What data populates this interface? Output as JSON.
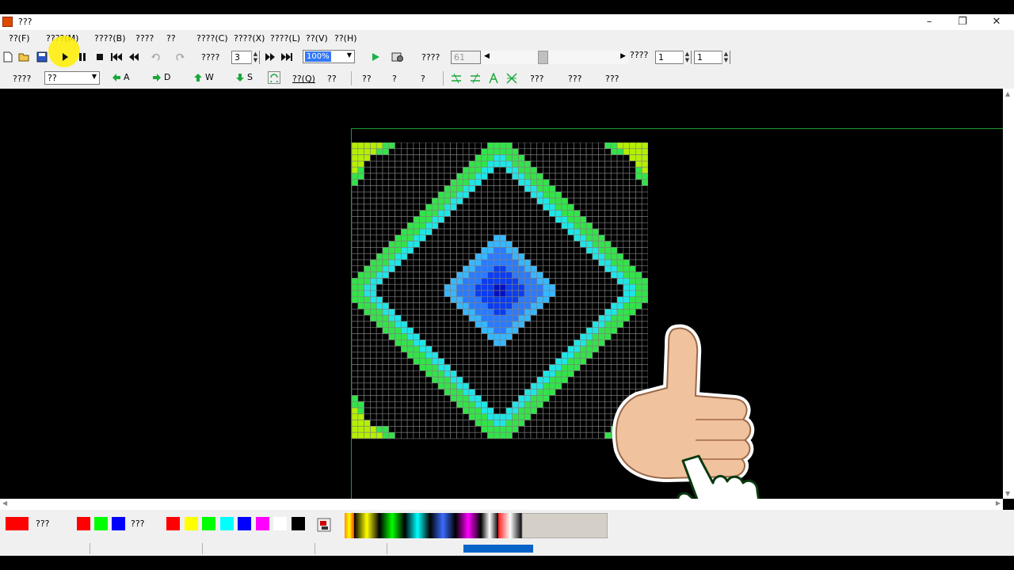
{
  "window": {
    "title": "???"
  },
  "menu": [
    "??(F)",
    "????(M)",
    "????(B)",
    "????",
    "??",
    "????(C)",
    "????(X)",
    "????(L)",
    "??(V)",
    "??(H)"
  ],
  "toolbar1": {
    "speed_label": "????",
    "speed_value": "3",
    "zoom_value": "100%",
    "frame_label": "????",
    "frame_value": "61",
    "page_label": "????",
    "page_value": "1",
    "page_total": "1"
  },
  "toolbar2": {
    "label_a": "????",
    "select_value": "??",
    "dir_left": "A",
    "dir_right": "D",
    "dir_up": "W",
    "dir_down": "S",
    "btn_q": "??(Q)",
    "btn_1": "??",
    "btn_2": "??",
    "btn_3": "?",
    "btn_4": "?",
    "btn_5": "???",
    "btn_6": "???",
    "btn_7": "???"
  },
  "palette": {
    "label_1": "???",
    "label_2": "???",
    "current_color": "#ff0000",
    "basic_colors": [
      "#ff0000",
      "#00ff00",
      "#0000ff"
    ],
    "colors": [
      "#ff0000",
      "#ffff00",
      "#00ff00",
      "#00ffff",
      "#0000ff",
      "#ff00ff",
      "#ffffff",
      "#000000"
    ]
  },
  "colors": {
    "grid_line": "#808080",
    "pattern_green": "#33e34a",
    "pattern_cyan": "#1fe6e6",
    "pattern_yellowgreen": "#b4f000",
    "pattern_blue": "#2a7bff",
    "pattern_darkblue": "#0010c0"
  }
}
